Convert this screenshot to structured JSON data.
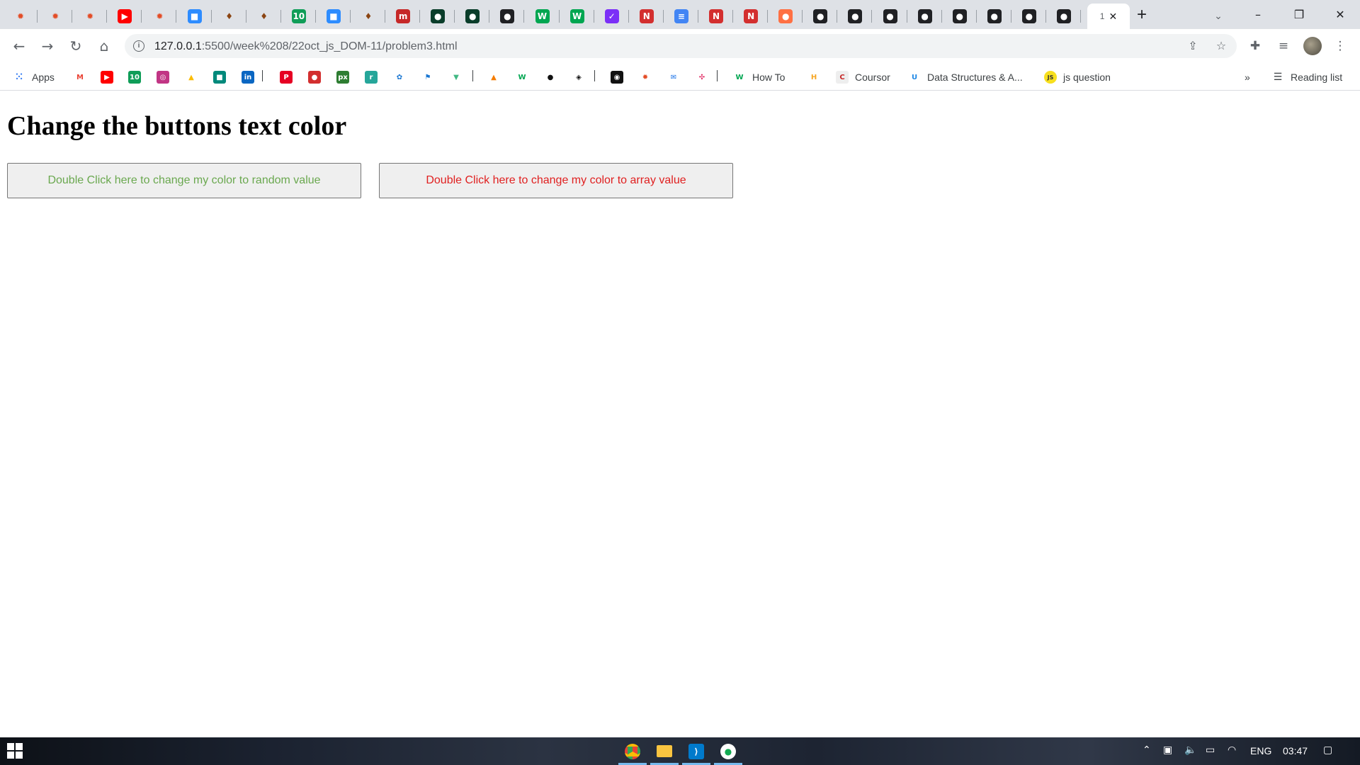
{
  "browser": {
    "tabs": [
      {
        "icon": "gear-icon",
        "color": "#e34c26",
        "glyph": "✹"
      },
      {
        "icon": "gear-icon",
        "color": "#e34c26",
        "glyph": "✹"
      },
      {
        "icon": "gear-icon",
        "color": "#e34c26",
        "glyph": "✹"
      },
      {
        "icon": "youtube-icon",
        "color": "#ff0000",
        "glyph": "▶"
      },
      {
        "icon": "gear-icon",
        "color": "#e34c26",
        "glyph": "✹"
      },
      {
        "icon": "zoom-icon",
        "color": "#2d8cff",
        "glyph": "■"
      },
      {
        "icon": "pin-icon",
        "color": "#8b4513",
        "glyph": "♦"
      },
      {
        "icon": "pin-icon",
        "color": "#8b4513",
        "glyph": "♦"
      },
      {
        "icon": "hangouts-icon",
        "color": "#0f9d58",
        "glyph": "10"
      },
      {
        "icon": "zoom-icon",
        "color": "#2d8cff",
        "glyph": "■"
      },
      {
        "icon": "pin-icon",
        "color": "#8b4513",
        "glyph": "♦"
      },
      {
        "icon": "m-icon",
        "color": "#c62828",
        "glyph": "m"
      },
      {
        "icon": "leaf-icon",
        "color": "#0a3d2a",
        "glyph": "●"
      },
      {
        "icon": "leaf-icon",
        "color": "#0a3d2a",
        "glyph": "●"
      },
      {
        "icon": "globe-icon",
        "color": "#202124",
        "glyph": "●"
      },
      {
        "icon": "w-icon",
        "color": "#00a651",
        "glyph": "W"
      },
      {
        "icon": "w-icon",
        "color": "#00a651",
        "glyph": "W"
      },
      {
        "icon": "check-icon",
        "color": "#7b2ff7",
        "glyph": "✓"
      },
      {
        "icon": "n-icon",
        "color": "#d32f2f",
        "glyph": "N"
      },
      {
        "icon": "docs-icon",
        "color": "#4285f4",
        "glyph": "≡"
      },
      {
        "icon": "n-icon",
        "color": "#d32f2f",
        "glyph": "N"
      },
      {
        "icon": "n-icon",
        "color": "#d32f2f",
        "glyph": "N"
      },
      {
        "icon": "circle-icon",
        "color": "#ff7043",
        "glyph": "●"
      },
      {
        "icon": "globe-icon",
        "color": "#202124",
        "glyph": "●"
      },
      {
        "icon": "globe-icon",
        "color": "#202124",
        "glyph": "●"
      },
      {
        "icon": "globe-icon",
        "color": "#202124",
        "glyph": "●"
      },
      {
        "icon": "globe-icon",
        "color": "#202124",
        "glyph": "●"
      },
      {
        "icon": "globe-icon",
        "color": "#202124",
        "glyph": "●"
      },
      {
        "icon": "globe-icon",
        "color": "#202124",
        "glyph": "●"
      },
      {
        "icon": "globe-icon",
        "color": "#202124",
        "glyph": "●"
      },
      {
        "icon": "globe-icon",
        "color": "#202124",
        "glyph": "●"
      }
    ],
    "active_tab_title": "1",
    "new_tab_label": "+",
    "url_host": "127.0.0.1",
    "url_path": ":5500/week%208/22oct_js_DOM-11/problem3.html"
  },
  "bookmarks": {
    "apps_label": "Apps",
    "how_to_label": "How To",
    "coursor_label": "Coursor",
    "dsa_label": "Data Structures & A...",
    "js_question_label": "js question",
    "js_badge": "JS",
    "more_label": "»",
    "reading_list_label": "Reading list"
  },
  "page": {
    "heading": "Change the buttons text color",
    "button_random_label": "Double Click here to change my color to random value",
    "button_random_color": "#6aa84f",
    "button_array_label": "Double Click here to change my color to array value",
    "button_array_color": "#e02020"
  },
  "taskbar": {
    "language": "ENG",
    "time": "03:47"
  }
}
